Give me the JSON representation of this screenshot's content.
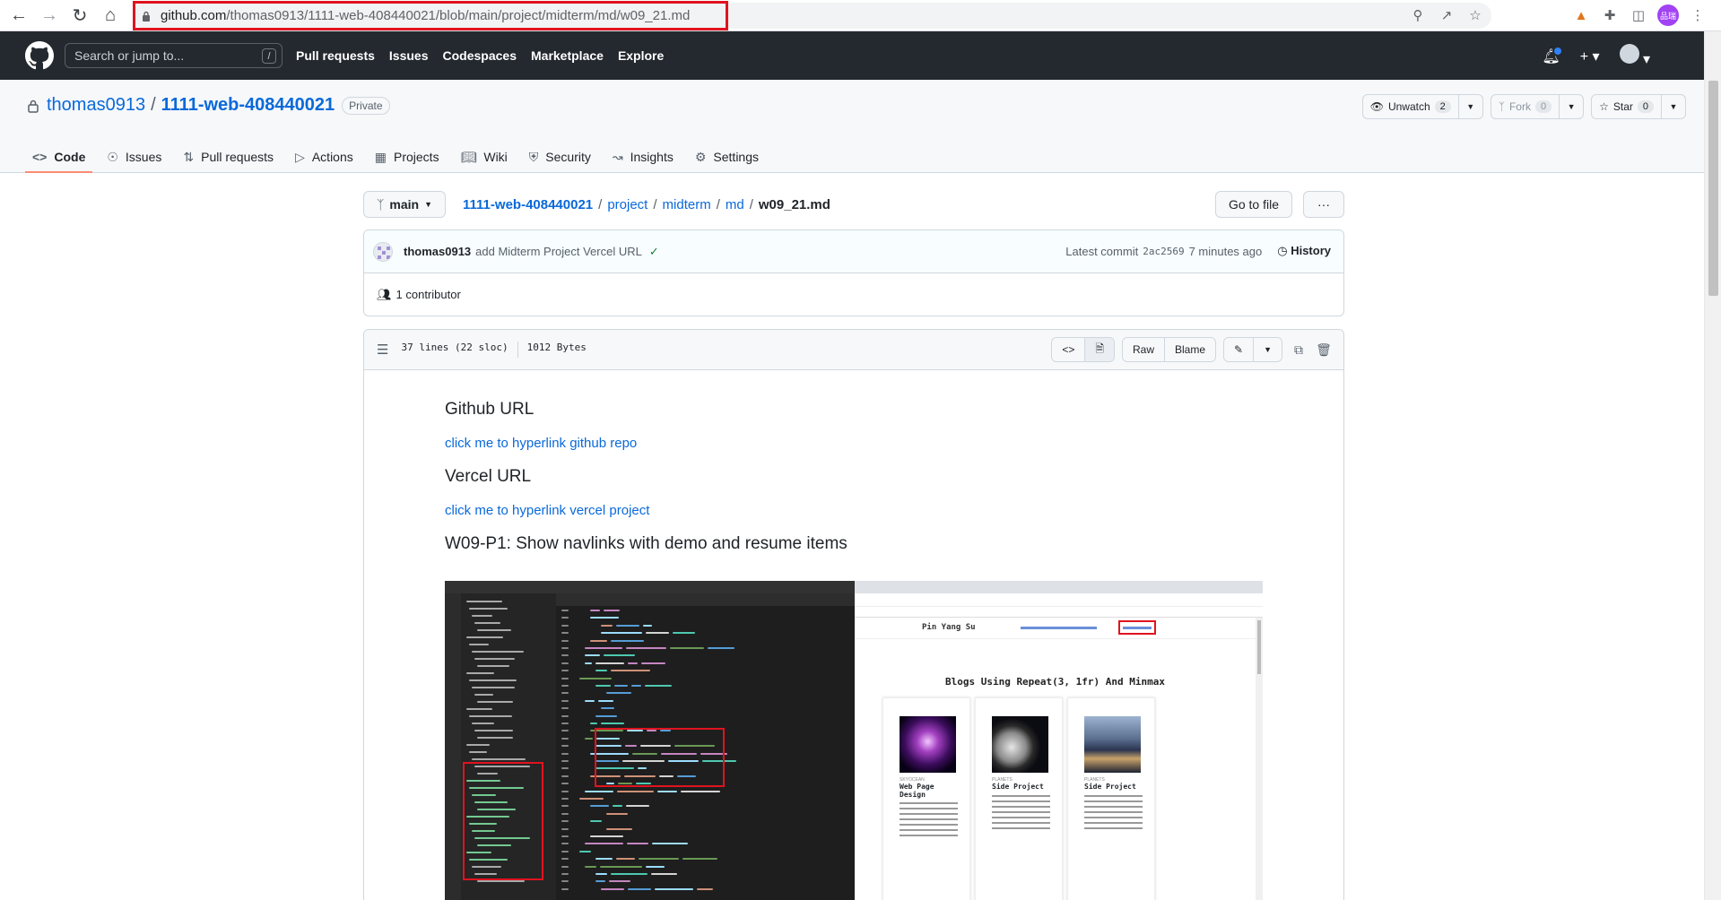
{
  "browser": {
    "url_host": "github.com",
    "url_path": "/thomas0913/1111-web-408440021/blob/main/project/midterm/md/w09_21.md",
    "profile_initials": "品瑞"
  },
  "github_header": {
    "search_placeholder": "Search or jump to...",
    "search_key": "/",
    "nav": [
      "Pull requests",
      "Issues",
      "Codespaces",
      "Marketplace",
      "Explore"
    ]
  },
  "repo": {
    "owner": "thomas0913",
    "name": "1111-web-408440021",
    "visibility": "Private",
    "watch_label": "Unwatch",
    "watch_count": "2",
    "fork_label": "Fork",
    "fork_count": "0",
    "star_label": "Star",
    "star_count": "0",
    "tabs": [
      "Code",
      "Issues",
      "Pull requests",
      "Actions",
      "Projects",
      "Wiki",
      "Security",
      "Insights",
      "Settings"
    ]
  },
  "file_nav": {
    "branch": "main",
    "crumbs": [
      "1111-web-408440021",
      "project",
      "midterm",
      "md"
    ],
    "current_file": "w09_21.md",
    "goto_label": "Go to file",
    "more_label": "···"
  },
  "commit": {
    "author": "thomas0913",
    "message": "add Midterm Project Vercel URL",
    "latest_label": "Latest commit",
    "sha": "2ac2569",
    "time": "7 minutes ago",
    "history_label": "History",
    "contributors": "1 contributor"
  },
  "file": {
    "lines": "37 lines (22 sloc)",
    "size": "1012 Bytes",
    "raw_label": "Raw",
    "blame_label": "Blame"
  },
  "markdown": {
    "h1": "Github URL",
    "link1": "click me to hyperlink github repo",
    "h2": "Vercel URL",
    "link2": "click me to hyperlink vercel project",
    "h3": "W09-P1: Show navlinks with demo and resume items"
  },
  "screenshot": {
    "site_brand": "Pin Yang Su",
    "site_heading": "Blogs Using Repeat(3, 1fr) And Minmax",
    "cards": [
      {
        "tag": "SKYOCEAN",
        "title": "Web Page Design"
      },
      {
        "tag": "PLANETS",
        "title": "Side Project"
      },
      {
        "tag": "PLANETS",
        "title": "Side Project"
      }
    ]
  }
}
